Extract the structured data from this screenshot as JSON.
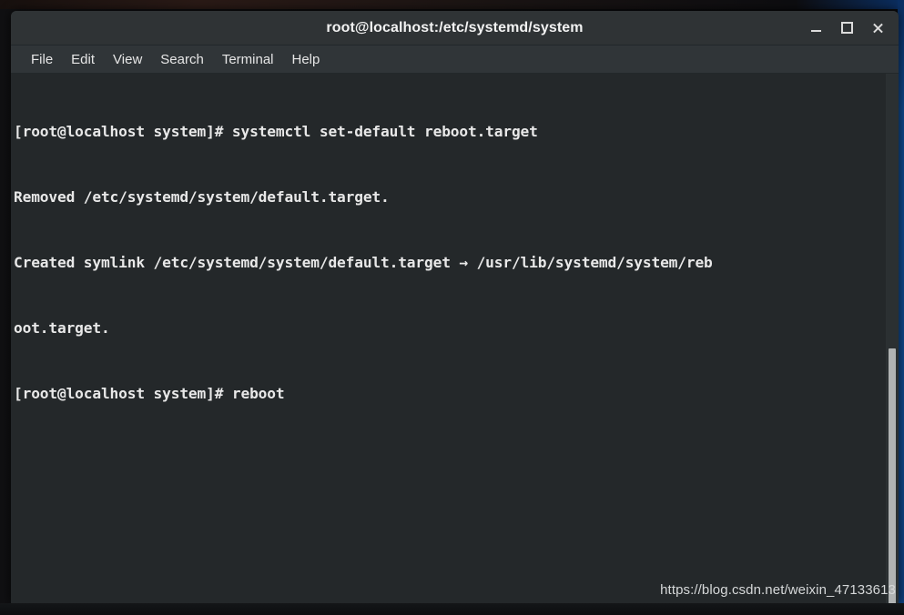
{
  "window": {
    "title": "root@localhost:/etc/systemd/system",
    "controls": [
      {
        "name": "minimize",
        "label": "_"
      },
      {
        "name": "maximize",
        "label": "□"
      },
      {
        "name": "close",
        "label": "×"
      }
    ]
  },
  "menu": {
    "items": [
      {
        "label": "File"
      },
      {
        "label": "Edit"
      },
      {
        "label": "View"
      },
      {
        "label": "Search"
      },
      {
        "label": "Terminal"
      },
      {
        "label": "Help"
      }
    ]
  },
  "terminal": {
    "prompt": "[root@localhost system]#",
    "lines": [
      "[root@localhost system]# systemctl set-default reboot.target",
      "Removed /etc/systemd/system/default.target.",
      "Created symlink /etc/systemd/system/default.target → /usr/lib/systemd/system/reb",
      "oot.target.",
      "[root@localhost system]# reboot"
    ],
    "background_color": "#24282a",
    "text_color": "#e8e8e8"
  },
  "scrollbar": {
    "orientation": "vertical",
    "thumb_position_percent": 52
  },
  "watermark": {
    "text": "https://blog.csdn.net/weixin_47133613"
  },
  "colors": {
    "titlebar": "#2f3335",
    "menubar": "#303538",
    "accent_blue": "#124a8d"
  }
}
